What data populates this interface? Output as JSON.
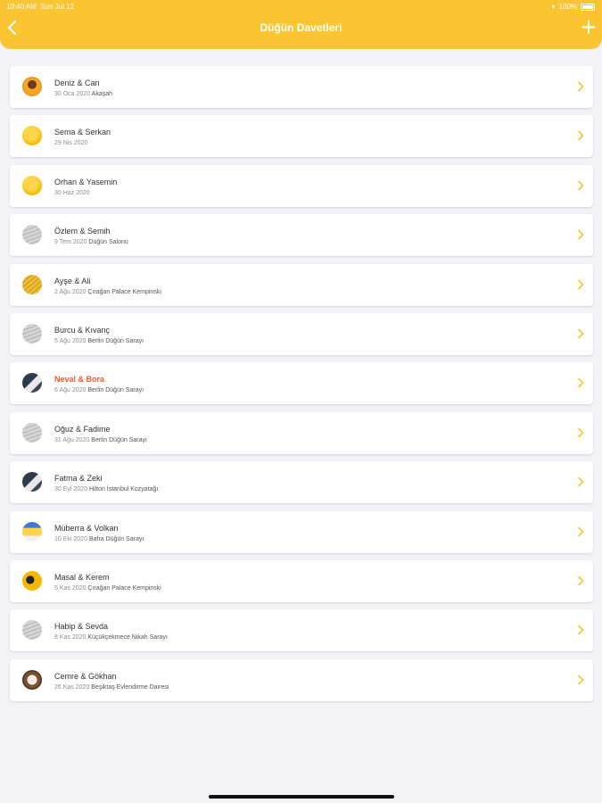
{
  "status": {
    "time": "10:40 AM",
    "date": "Sun Jul 12",
    "battery": "100%"
  },
  "header": {
    "title": "Düğün Davetleri",
    "back_icon": "chevron-left-icon",
    "add_icon": "plus-icon"
  },
  "colors": {
    "accent": "#fbc531",
    "highlight": "#f05a28"
  },
  "invitations": [
    {
      "name": "Deniz & Can",
      "date": "30 Oca 2020",
      "venue": "Akaşah",
      "avatar": "person-avatar"
    },
    {
      "name": "Sema & Serkan",
      "date": "29 Nis 2020",
      "venue": "",
      "avatar": "gold-coin-avatar"
    },
    {
      "name": "Orhan & Yasemin",
      "date": "30 Haz 2020",
      "venue": "",
      "avatar": "gold-coin-avatar"
    },
    {
      "name": "Özlem & Semih",
      "date": "9 Tem 2020",
      "venue": "Düğün Salonu",
      "avatar": "silver-pattern-avatar"
    },
    {
      "name": "Ayşe & Ali",
      "date": "2 Ağu 2020",
      "venue": "Çırağan Palace Kempinski",
      "avatar": "gold-pattern-avatar"
    },
    {
      "name": "Burcu & Kıvanç",
      "date": "5 Ağu 2020",
      "venue": "Berlin Düğün Sarayı",
      "avatar": "silver-pattern-avatar"
    },
    {
      "name": "Neval & Bora",
      "date": "6 Ağu 2020",
      "venue": "Berlin Düğün Sarayı",
      "avatar": "dark-photo-avatar",
      "highlighted": true
    },
    {
      "name": "Oğuz & Fadime",
      "date": "31 Ağu 2020",
      "venue": "Berlin Düğün Sarayı",
      "avatar": "silver-pattern-avatar"
    },
    {
      "name": "Fatma & Zeki",
      "date": "30 Eyl 2020",
      "venue": "Hilton İstanbul Kozyatağı",
      "avatar": "dark-photo-avatar"
    },
    {
      "name": "Müberra & Volkan",
      "date": "10 Eki 2020",
      "venue": "Bafra Düğün Sarayı",
      "avatar": "card-avatar"
    },
    {
      "name": "Masal & Kerem",
      "date": "5 Kas 2020",
      "venue": "Çırağan Palace Kempinski",
      "avatar": "yellow-photo-avatar"
    },
    {
      "name": "Habip & Sevda",
      "date": "8 Kas 2020",
      "venue": "Küçükçekmece Nikah Sarayı",
      "avatar": "silver-pattern-avatar"
    },
    {
      "name": "Cemre & Gökhan",
      "date": "26 Kas 2020",
      "venue": "Beşiktaş Evlendirme Dairesi",
      "avatar": "brown-photo-avatar"
    }
  ]
}
